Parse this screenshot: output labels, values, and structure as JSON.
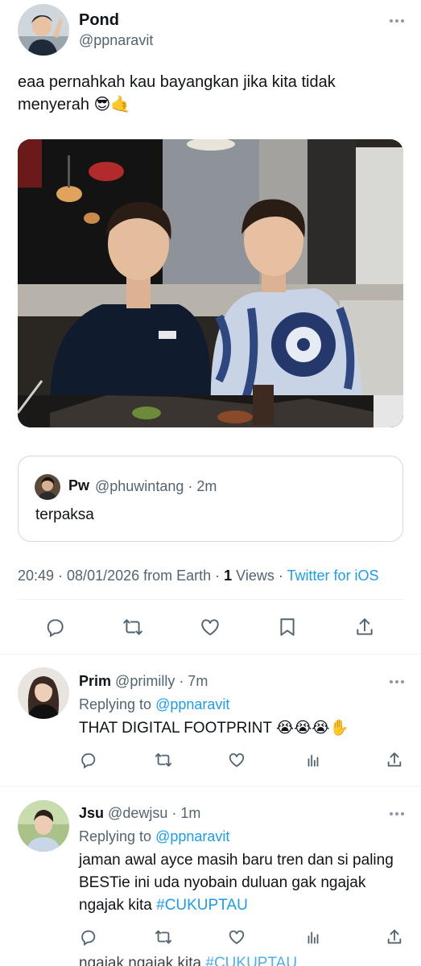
{
  "main_tweet": {
    "name": "Pond",
    "handle": "@ppnaravit",
    "text": "eaa pernahkah kau bayangkan jika kita tidak menyerah 😎🤙",
    "photo_icon": "photo-image",
    "quote": {
      "name": "Pw",
      "handle": "@phuwintang · 2m",
      "text": "terpaksa"
    },
    "meta": {
      "time": "20:49 · 08/01/2026 from Earth · ",
      "views_count": "1",
      "views_label": " Views · ",
      "client": "Twitter for iOS"
    },
    "actions": [
      "reply-icon",
      "retweet-icon",
      "like-icon",
      "bookmark-icon",
      "share-icon"
    ]
  },
  "replies": [
    {
      "name": "Prim",
      "handle": "@primilly · 7m",
      "replying_label": "Replying to ",
      "replying_to": "@ppnaravit",
      "text": "THAT DIGITAL FOOTPRINT 😭😭😭✋"
    },
    {
      "name": "Jsu",
      "handle": "@dewjsu · 1m",
      "replying_label": "Replying to ",
      "replying_to": "@ppnaravit",
      "text": "jaman awal ayce masih baru tren dan si paling BESTie ini uda nyobain duluan gak ngajak ngajak kita ",
      "hashtag": "#CUKUPTAU"
    }
  ],
  "cut_off_line": {
    "text": "ngajak ngajak kita ",
    "hashtag": "#CUKUPTAU"
  },
  "colors": {
    "accent": "#1d9bf0",
    "secondary_text": "#536471",
    "divider": "#eff3f4"
  }
}
